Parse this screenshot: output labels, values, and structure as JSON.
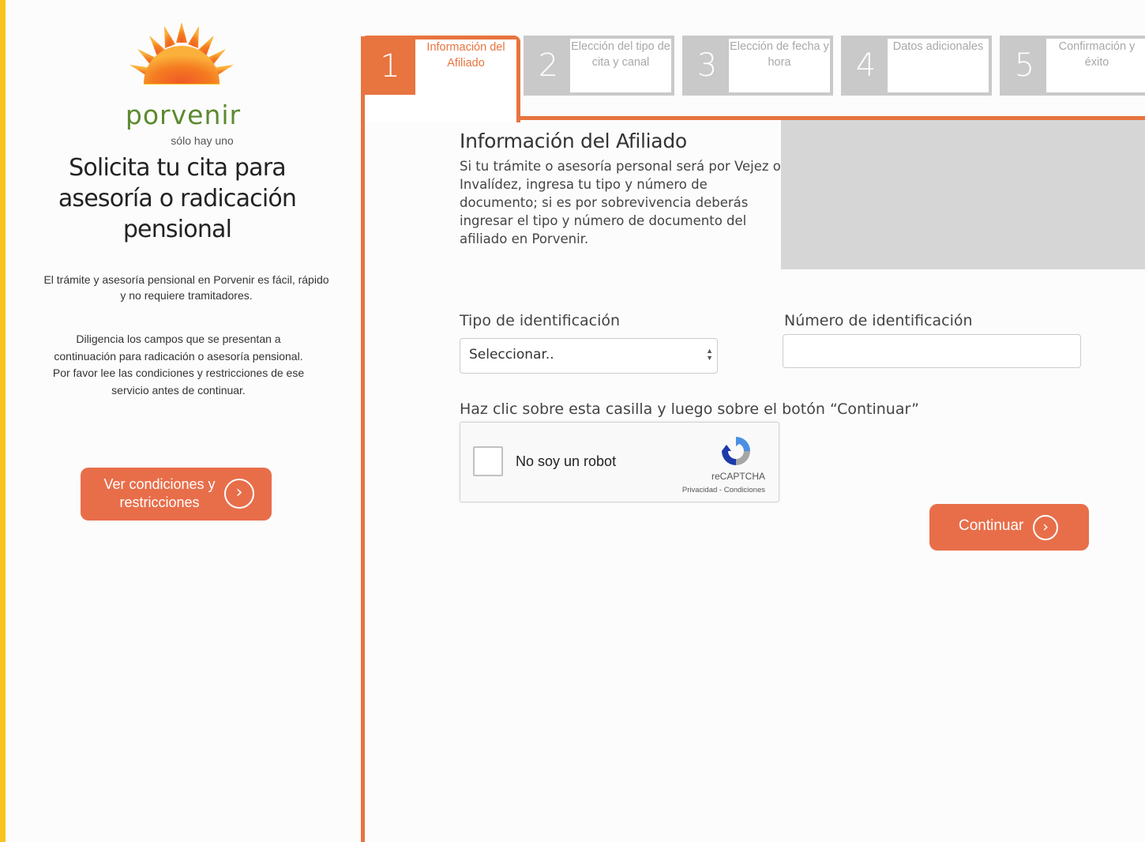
{
  "brand": {
    "name": "porvenir",
    "tagline": "sólo hay uno",
    "colors": {
      "sun_orange": "#e8743f",
      "sun_yellow": "#f9c31f",
      "green": "#5b8a2e"
    }
  },
  "sidebar": {
    "title": "Solicita tu cita para asesoría o radicación pensional",
    "paragraph1": "El trámite y asesoría pensional en Porvenir es fácil, rápido y no requiere tramitadores.",
    "paragraph2": "Diligencia los campos que se presentan a continuación para radicación o asesoría pensional. Por favor lee las condiciones y restricciones de ese servicio antes de continuar.",
    "conditions_button": "Ver condiciones y restricciones",
    "button_icon": "chevron-right-circle-icon"
  },
  "steps": [
    {
      "number": "1",
      "label": "Información del Afiliado",
      "active": true
    },
    {
      "number": "2",
      "label": "Elección del tipo de cita y canal",
      "active": false
    },
    {
      "number": "3",
      "label": "Elección de fecha y hora",
      "active": false
    },
    {
      "number": "4",
      "label": "Datos adicionales",
      "active": false
    },
    {
      "number": "5",
      "label": "Confirmación y éxito",
      "active": false
    }
  ],
  "form": {
    "title": "Información del Afiliado",
    "description": "Si tu trámite o asesoría personal será por Vejez o Invalídez, ingresa tu tipo y número de documento; si es por sobrevivencia deberás ingresar el tipo y número de documento del afiliado en Porvenir.",
    "id_type_label": "Tipo de identificación",
    "id_type_value": "Seleccionar..",
    "id_number_label": "Número de identificación",
    "id_number_value": "",
    "captcha_instruction": "Haz clic sobre esta casilla y luego sobre el botón “Continuar”",
    "captcha": {
      "label": "No soy un robot",
      "brand": "reCAPTCHA",
      "links": "Privacidad - Condiciones"
    },
    "continue_button": "Continuar"
  },
  "accent": "#e86e4a"
}
